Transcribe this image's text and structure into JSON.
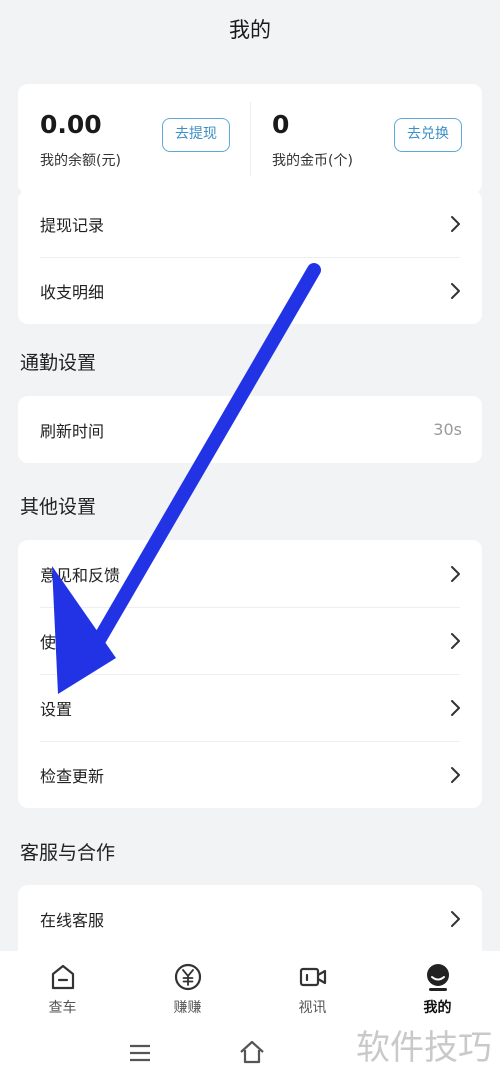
{
  "header": {
    "title": "我的"
  },
  "wallet": {
    "balance_value": "0.00",
    "balance_label": "我的余额(元)",
    "withdraw_button": "去提现",
    "coins_value": "0",
    "coins_label": "我的金币(个)",
    "exchange_button": "去兑换"
  },
  "account_rows": [
    {
      "label": "提现记录"
    },
    {
      "label": "收支明细"
    }
  ],
  "commute": {
    "title": "通勤设置",
    "refresh_label": "刷新时间",
    "refresh_value": "30s"
  },
  "other": {
    "title": "其他设置",
    "items": [
      {
        "label": "意见和反馈"
      },
      {
        "label": "使用帮助"
      },
      {
        "label": "设置"
      },
      {
        "label": "检查更新"
      }
    ]
  },
  "service": {
    "title": "客服与合作",
    "online_label": "在线客服"
  },
  "nav": [
    {
      "label": "查车",
      "icon": "car-check-icon"
    },
    {
      "label": "赚赚",
      "icon": "yuan-coin-icon"
    },
    {
      "label": "视讯",
      "icon": "video-icon"
    },
    {
      "label": "我的",
      "icon": "profile-icon"
    }
  ],
  "watermark": "软件技巧",
  "colors": {
    "accent": "#3d8fc6",
    "arrow": "#2233e6",
    "background": "#f2f3f5"
  }
}
